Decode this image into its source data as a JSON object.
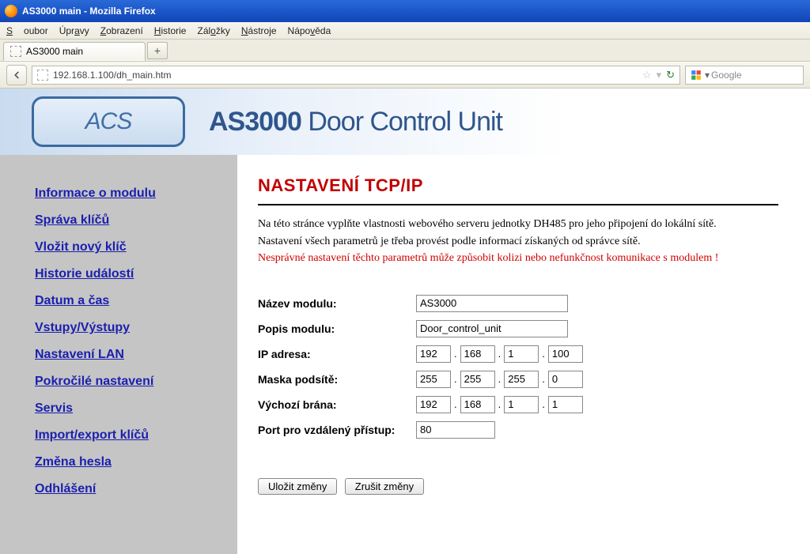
{
  "window": {
    "title": "AS3000 main - Mozilla Firefox"
  },
  "menu": {
    "soubor": "Soubor",
    "upravy": "Úpravy",
    "zobrazeni": "Zobrazení",
    "historie": "Historie",
    "zalozky": "Záložky",
    "nastroje": "Nástroje",
    "napoveda": "Nápověda"
  },
  "tab": {
    "label": "AS3000 main"
  },
  "url": {
    "value": "192.168.1.100/dh_main.htm"
  },
  "search": {
    "placeholder": "Google"
  },
  "header": {
    "logo_text": "ACS",
    "title_bold": "AS3000",
    "title_rest": " Door Control Unit"
  },
  "sidebar": {
    "items": [
      "Informace o modulu",
      "Správa klíčů",
      "Vložit nový klíč",
      "Historie událostí",
      "Datum a čas",
      "Vstupy/Výstupy",
      "Nastavení LAN",
      "Pokročilé nastavení",
      "Servis",
      "Import/export klíčů",
      "Změna hesla",
      "Odhlášení"
    ]
  },
  "content": {
    "heading": "NASTAVENÍ TCP/IP",
    "para1": "Na této stránce vyplňte vlastnosti webového serveru jednotky DH485 pro jeho připojení do lokální sítě.",
    "para2": "Nastavení všech parametrů je třeba provést podle informací získaných od správce sítě.",
    "warn": "Nesprávné nastavení těchto parametrů může způsobit kolizi nebo nefunkčnost komunikace s modulem !",
    "labels": {
      "nazev": "Název modulu:",
      "popis": "Popis modulu:",
      "ip": "IP adresa:",
      "mask": "Maska podsítě:",
      "gw": "Výchozí brána:",
      "port": "Port pro vzdálený přístup:"
    },
    "values": {
      "nazev": "AS3000",
      "popis": "Door_control_unit",
      "ip": [
        "192",
        "168",
        "1",
        "100"
      ],
      "mask": [
        "255",
        "255",
        "255",
        "0"
      ],
      "gw": [
        "192",
        "168",
        "1",
        "1"
      ],
      "port": "80"
    },
    "buttons": {
      "save": "Uložit změny",
      "cancel": "Zrušit změny"
    }
  }
}
